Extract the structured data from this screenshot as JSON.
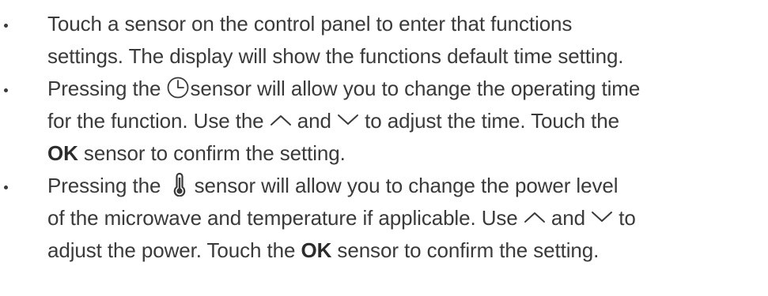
{
  "items": [
    {
      "lines": [
        "Touch a sensor on the control panel to enter that functions",
        "settings. The display  will show the functions default time setting."
      ]
    },
    {
      "line1_before": "Pressing the ",
      "line1_after": "sensor will allow you to change the operating time",
      "line2_a": "for the function. Use the ",
      "line2_b": " and ",
      "line2_c": " to adjust the time. Touch the",
      "line3_bold": "OK",
      "line3_rest": " sensor to confirm the setting.",
      "icon": "clock-icon"
    },
    {
      "line1_before": "Pressing the ",
      "line1_after": " sensor will allow you to change the power level",
      "line2_a": "of the microwave and temperature if applicable. Use ",
      "line2_b": " and ",
      "line2_c": " to",
      "line3_a": "adjust the power. Touch the ",
      "line3_bold": "OK",
      "line3_rest": " sensor to confirm the setting.",
      "icon": "thermometer-icon"
    }
  ],
  "icons": {
    "up": "chevron-up-icon",
    "down": "chevron-down-icon"
  }
}
